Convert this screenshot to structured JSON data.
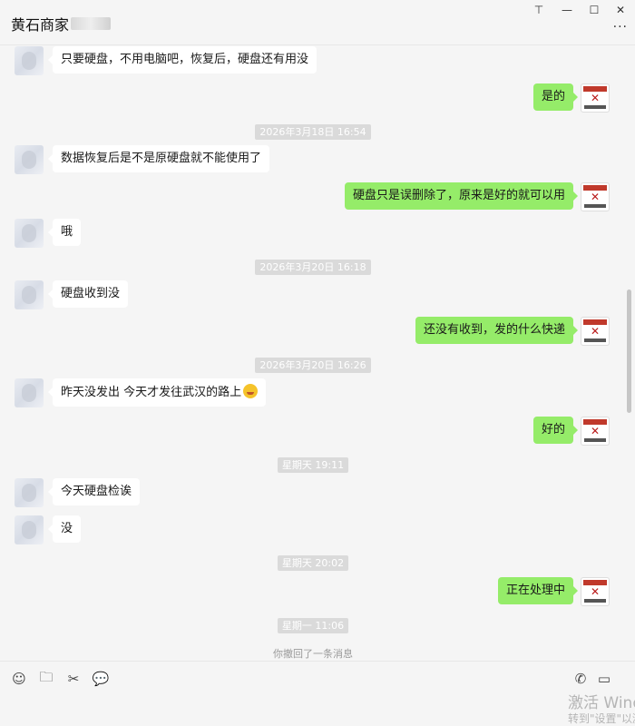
{
  "window": {
    "contact_name": "黄石商家",
    "pin_label": "⊤",
    "minimize_label": "—",
    "maximize_label": "☐",
    "close_label": "✕",
    "more_label": "···"
  },
  "messages": [
    {
      "type": "msg",
      "side": "left",
      "text": "只要硬盘，不用电脑吧，恢复后，硬盘还有用没"
    },
    {
      "type": "msg",
      "side": "right",
      "text": "是的"
    },
    {
      "type": "time",
      "text": "2026年3月18日 16:54"
    },
    {
      "type": "msg",
      "side": "left",
      "text": "数据恢复后是不是原硬盘就不能使用了"
    },
    {
      "type": "msg",
      "side": "right",
      "text": "硬盘只是误删除了，原来是好的就可以用"
    },
    {
      "type": "msg",
      "side": "left",
      "text": "哦"
    },
    {
      "type": "time",
      "text": "2026年3月20日 16:18"
    },
    {
      "type": "msg",
      "side": "left",
      "text": "硬盘收到没"
    },
    {
      "type": "msg",
      "side": "right",
      "text": "还没有收到，发的什么快递"
    },
    {
      "type": "time",
      "text": "2026年3月20日 16:26"
    },
    {
      "type": "msg",
      "side": "left",
      "text": "昨天没发出 今天才发往武汉的路上",
      "emoji": "grin-sweat"
    },
    {
      "type": "msg",
      "side": "right",
      "text": "好的"
    },
    {
      "type": "time",
      "text": "星期天 19:11"
    },
    {
      "type": "msg",
      "side": "left",
      "text": "今天硬盘检诶"
    },
    {
      "type": "msg",
      "side": "left",
      "text": "没"
    },
    {
      "type": "time",
      "text": "星期天 20:02"
    },
    {
      "type": "msg",
      "side": "right",
      "text": "正在处理中"
    },
    {
      "type": "time",
      "text": "星期一 11:06"
    },
    {
      "type": "recall",
      "text": "你撤回了一条消息"
    }
  ],
  "toolbar": {
    "emoji_icon": "☺",
    "folder_icon": "🗀",
    "screenshot_icon": "✂",
    "chat_history_icon": "💬",
    "phone_icon": "✆",
    "video_icon": "▭"
  },
  "watermark": {
    "line1": "激活 Windows",
    "line2": "转到\"设置\"以激活 Windows。"
  },
  "colors": {
    "bubble_self": "#95ec69",
    "bubble_other": "#ffffff",
    "background": "#f5f5f5"
  }
}
